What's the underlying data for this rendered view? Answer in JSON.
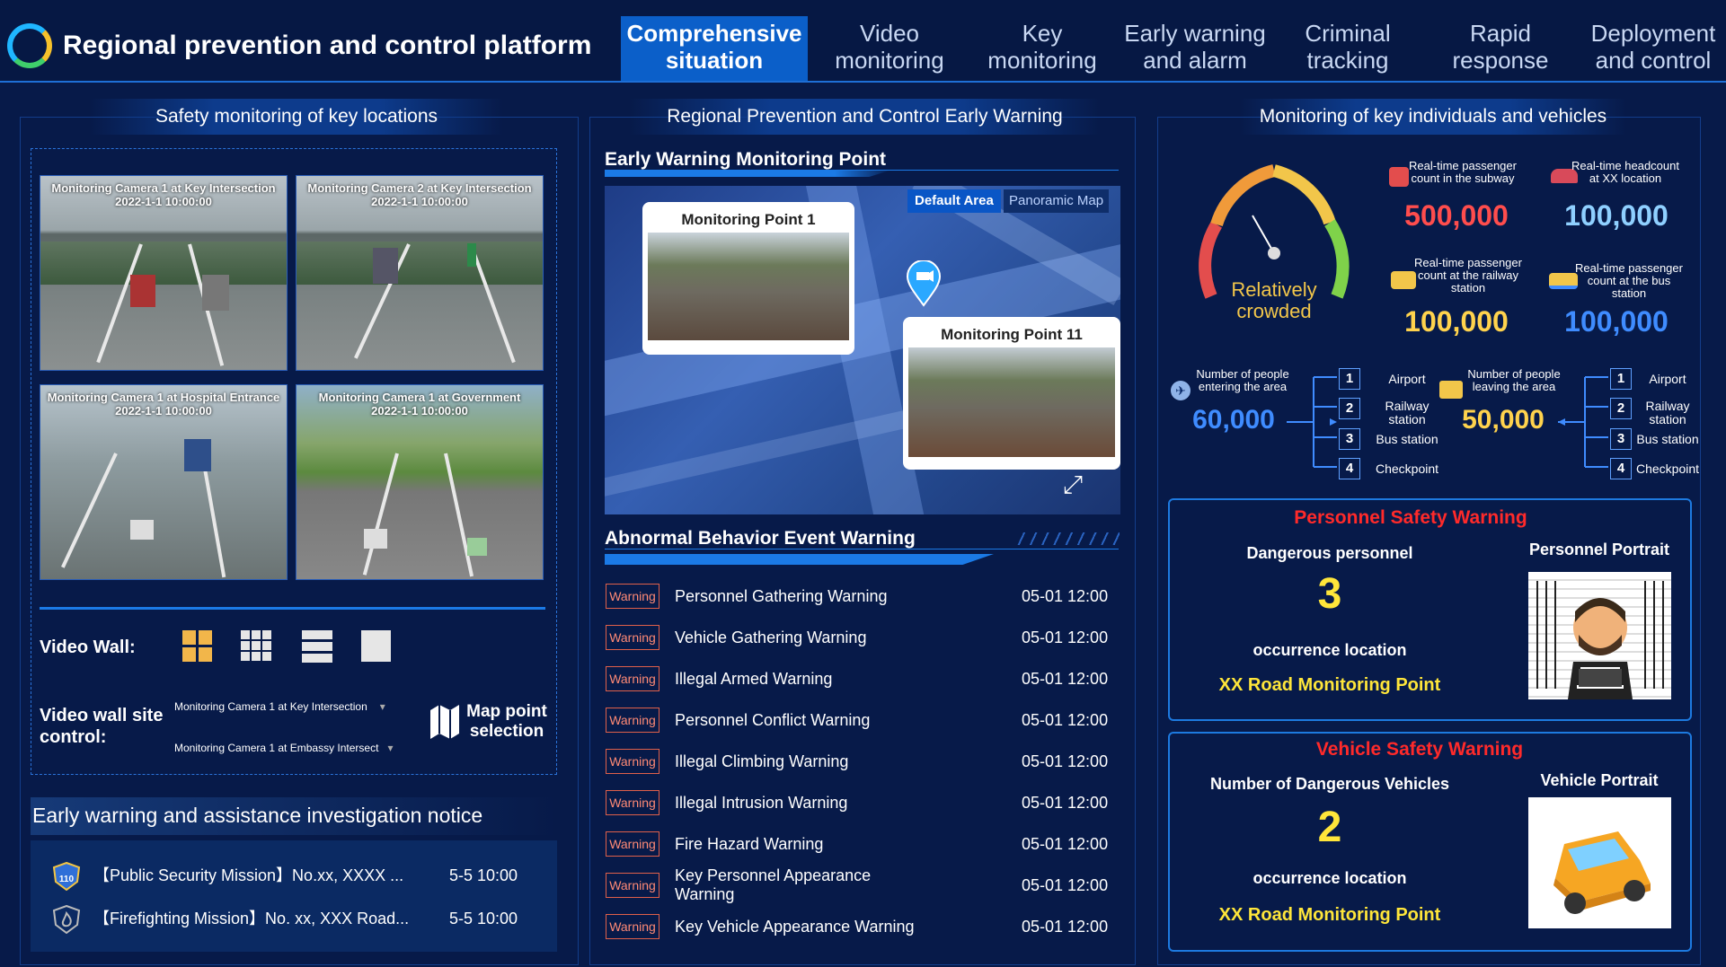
{
  "header": {
    "title": "Regional prevention and control platform",
    "nav": [
      {
        "label": "Comprehensive situation"
      },
      {
        "label": "Video monitoring"
      },
      {
        "label": "Key monitoring"
      },
      {
        "label": "Early warning and alarm"
      },
      {
        "label": "Criminal tracking"
      },
      {
        "label": "Rapid response"
      },
      {
        "label": "Deployment and control"
      }
    ]
  },
  "left": {
    "title": "Safety monitoring of key locations",
    "cameras": [
      {
        "name": "Monitoring Camera 1 at Key Intersection",
        "time": "2022-1-1 10:00:00"
      },
      {
        "name": "Monitoring Camera 2 at Key Intersection",
        "time": "2022-1-1 10:00:00"
      },
      {
        "name": "Monitoring Camera 1 at  Hospital Entrance",
        "time": "2022-1-1 10:00:00"
      },
      {
        "name": "Monitoring Camera 1 at Government",
        "time": "2022-1-1 10:00:00"
      }
    ],
    "video_wall_label": "Video Wall:",
    "video_wall_control_label": "Video wall site control:",
    "select1": "Monitoring Camera 1 at Key Intersection",
    "select2": "Monitoring Camera 1 at Embassy Intersect",
    "map_point_label": "Map point selection",
    "notice_title": "Early warning and assistance investigation notice",
    "notices": [
      {
        "text": "【Public Security Mission】No.xx, XXXX ...",
        "time": "5-5 10:00",
        "badge": "110"
      },
      {
        "text": "【Firefighting Mission】No. xx, XXX Road...",
        "time": "5-5 10:00"
      }
    ]
  },
  "middle": {
    "title": "Regional Prevention and Control Early Warning",
    "ewmp_title": "Early Warning Monitoring Point",
    "tab_default": "Default Area",
    "tab_panoramic": "Panoramic Map",
    "point1": "Monitoring Point 1",
    "point2": "Monitoring Point 11",
    "abnormal_title": "Abnormal Behavior Event Warning",
    "warn_badge": "Warning",
    "warnings": [
      {
        "text": "Personnel Gathering Warning",
        "time": "05-01 12:00"
      },
      {
        "text": "Vehicle Gathering Warning",
        "time": "05-01 12:00"
      },
      {
        "text": "Illegal Armed Warning",
        "time": "05-01 12:00"
      },
      {
        "text": "Personnel Conflict Warning",
        "time": "05-01 12:00"
      },
      {
        "text": "Illegal Climbing Warning",
        "time": "05-01 12:00"
      },
      {
        "text": "Illegal Intrusion Warning",
        "time": "05-01 12:00"
      },
      {
        "text": "Fire Hazard Warning",
        "time": "05-01 12:00"
      },
      {
        "text": "Key Personnel Appearance Warning",
        "time": "05-01 12:00"
      },
      {
        "text": "Key Vehicle Appearance Warning",
        "time": "05-01 12:00"
      }
    ]
  },
  "right": {
    "title": "Monitoring of key individuals and vehicles",
    "gauge_label": "Relatively crowded",
    "stats": [
      {
        "label": "Real-time passenger count in the subway",
        "value": "500,000",
        "color": "#ff4d4d"
      },
      {
        "label": "Real-time headcount at XX location",
        "value": "100,000",
        "color": "#8fd0ff"
      },
      {
        "label": "Real-time passenger count at the railway station",
        "value": "100,000",
        "color": "#ffd34d"
      },
      {
        "label": "Real-time passenger count at the bus station",
        "value": "100,000",
        "color": "#3f8cff"
      }
    ],
    "entering_label": "Number of people entering the area",
    "entering_value": "60,000",
    "leaving_label": "Number of people leaving the area",
    "leaving_value": "50,000",
    "points": [
      {
        "num": "1",
        "label": "Airport"
      },
      {
        "num": "2",
        "label": "Railway station"
      },
      {
        "num": "3",
        "label": "Bus station"
      },
      {
        "num": "4",
        "label": "Checkpoint"
      }
    ],
    "personnel": {
      "title": "Personnel Safety Warning",
      "count_label": "Dangerous personnel",
      "count": "3",
      "loc_label": "occurrence location",
      "loc": "XX Road Monitoring Point",
      "portrait": "Personnel Portrait"
    },
    "vehicle": {
      "title": "Vehicle Safety Warning",
      "count_label": "Number of Dangerous Vehicles",
      "count": "2",
      "loc_label": "occurrence location",
      "loc": "XX Road Monitoring Point",
      "portrait": "Vehicle Portrait"
    }
  }
}
